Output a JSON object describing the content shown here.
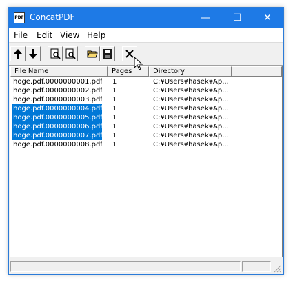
{
  "window": {
    "title": "ConcatPDF",
    "app_icon_text": "PDF",
    "controls": {
      "minimize": "—",
      "maximize": "☐",
      "close": "✕"
    }
  },
  "menu": [
    "File",
    "Edit",
    "View",
    "Help"
  ],
  "toolbar": {
    "buttons": [
      "move-up-icon",
      "move-down-icon",
      "preview-pdf-icon",
      "preview-pdf-icon",
      "open-folder-icon",
      "save-icon",
      "delete-icon"
    ]
  },
  "list": {
    "columns": [
      "File Name",
      "Pages",
      "Directory"
    ],
    "rows": [
      {
        "name": "hoge.pdf.0000000001.pdf",
        "pages": "1",
        "dir": "C:¥Users¥hasek¥Ap...",
        "selected": false
      },
      {
        "name": "hoge.pdf.0000000002.pdf",
        "pages": "1",
        "dir": "C:¥Users¥hasek¥Ap...",
        "selected": false
      },
      {
        "name": "hoge.pdf.0000000003.pdf",
        "pages": "1",
        "dir": "C:¥Users¥hasek¥Ap...",
        "selected": false
      },
      {
        "name": "hoge.pdf.0000000004.pdf",
        "pages": "1",
        "dir": "C:¥Users¥hasek¥Ap...",
        "selected": true
      },
      {
        "name": "hoge.pdf.0000000005.pdf",
        "pages": "1",
        "dir": "C:¥Users¥hasek¥Ap...",
        "selected": true
      },
      {
        "name": "hoge.pdf.0000000006.pdf",
        "pages": "1",
        "dir": "C:¥Users¥hasek¥Ap...",
        "selected": true
      },
      {
        "name": "hoge.pdf.0000000007.pdf",
        "pages": "1",
        "dir": "C:¥Users¥hasek¥Ap...",
        "selected": true
      },
      {
        "name": "hoge.pdf.0000000008.pdf",
        "pages": "1",
        "dir": "C:¥Users¥hasek¥Ap...",
        "selected": false
      }
    ]
  },
  "colors": {
    "titlebar": "#1e7ae6",
    "selection": "#0078d7"
  }
}
